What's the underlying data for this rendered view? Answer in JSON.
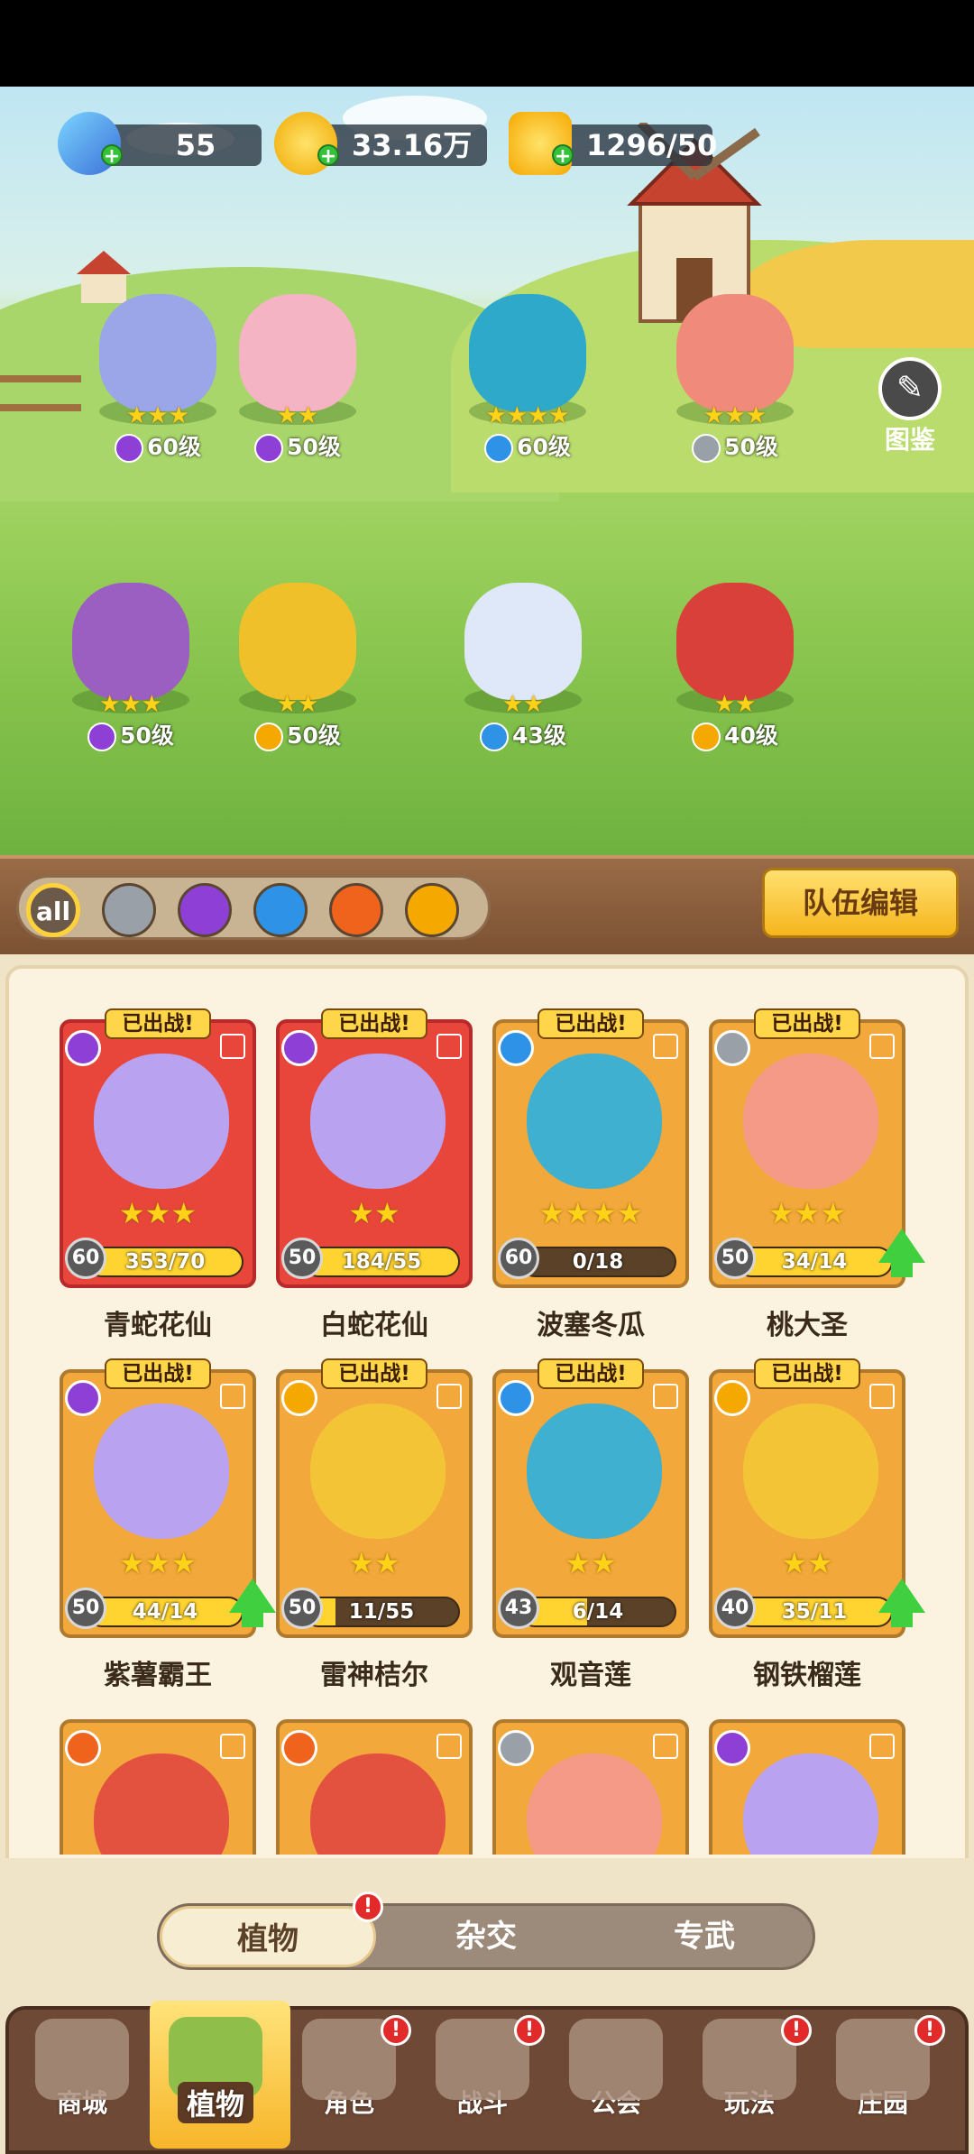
{
  "resources": {
    "gems": "55",
    "gold": "33.16万",
    "energy": "1296/50"
  },
  "atlas_label": "图鉴",
  "lineup": [
    {
      "stars": "★★★",
      "element": "purple",
      "level": "60级"
    },
    {
      "stars": "★★",
      "element": "purple",
      "level": "50级"
    },
    {
      "stars": "★★★★",
      "element": "water",
      "level": "60级"
    },
    {
      "stars": "★★★",
      "element": "sword",
      "level": "50级"
    },
    {
      "stars": "★★★",
      "element": "purple",
      "level": "50级"
    },
    {
      "stars": "★★",
      "element": "bolt",
      "level": "50级"
    },
    {
      "stars": "★★",
      "element": "water",
      "level": "43级"
    },
    {
      "stars": "★★",
      "element": "bolt",
      "level": "40级"
    }
  ],
  "filters": {
    "all_label": "all",
    "team_edit_label": "队伍编辑"
  },
  "deployed_badge": "已出战!",
  "plants": [
    {
      "name": "青蛇花仙",
      "level": "60",
      "progress": "353/70",
      "stars": "★★★",
      "element": "purple",
      "color": "red",
      "fill": 1.0,
      "upgrade": false
    },
    {
      "name": "白蛇花仙",
      "level": "50",
      "progress": "184/55",
      "stars": "★★",
      "element": "purple",
      "color": "red",
      "fill": 1.0,
      "upgrade": false
    },
    {
      "name": "波塞冬瓜",
      "level": "60",
      "progress": "0/18",
      "stars": "★★★★",
      "element": "water",
      "color": "gold",
      "fill": 0.0,
      "upgrade": false
    },
    {
      "name": "桃大圣",
      "level": "50",
      "progress": "34/14",
      "stars": "★★★",
      "element": "sword",
      "color": "gold",
      "fill": 1.0,
      "upgrade": true
    },
    {
      "name": "紫薯霸王",
      "level": "50",
      "progress": "44/14",
      "stars": "★★★",
      "element": "purple",
      "color": "gold",
      "fill": 1.0,
      "upgrade": true
    },
    {
      "name": "雷神桔尔",
      "level": "50",
      "progress": "11/55",
      "stars": "★★",
      "element": "bolt",
      "color": "gold",
      "fill": 0.2,
      "upgrade": false
    },
    {
      "name": "观音莲",
      "level": "43",
      "progress": "6/14",
      "stars": "★★",
      "element": "water",
      "color": "gold",
      "fill": 0.43,
      "upgrade": false
    },
    {
      "name": "钢铁榴莲",
      "level": "40",
      "progress": "35/11",
      "stars": "★★",
      "element": "bolt",
      "color": "gold",
      "fill": 1.0,
      "upgrade": true
    }
  ],
  "partial_row": [
    "fire",
    "fire",
    "sword",
    "purple"
  ],
  "subtabs": [
    "植物",
    "杂交",
    "专武"
  ],
  "alert_mark": "!",
  "nav": [
    "商城",
    "植物",
    "角色",
    "战斗",
    "公会",
    "玩法",
    "庄园"
  ]
}
